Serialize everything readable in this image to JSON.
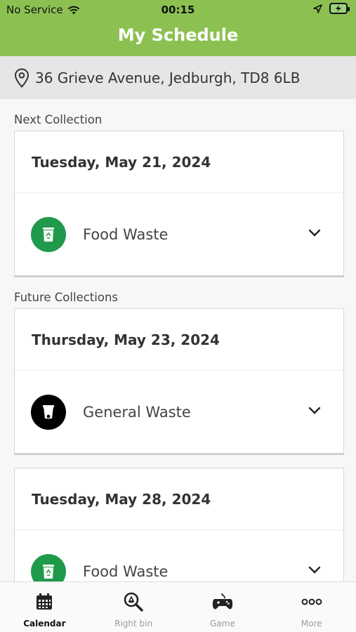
{
  "status_bar": {
    "carrier": "No Service",
    "time": "00:15"
  },
  "header": {
    "title": "My Schedule"
  },
  "address": {
    "text": "36 Grieve Avenue, Jedburgh, TD8 6LB",
    "icon": "location-pin-icon"
  },
  "next_collection": {
    "label": "Next Collection",
    "date": "Tuesday, May 21, 2024",
    "bin": "Food Waste"
  },
  "future_collections": {
    "label": "Future Collections",
    "items": [
      {
        "date": "Thursday, May 23, 2024",
        "bin": "General Waste"
      },
      {
        "date": "Tuesday, May 28, 2024",
        "bin": "Food Waste"
      }
    ]
  },
  "tabs": [
    {
      "label": "Calendar",
      "icon": "calendar-icon",
      "active": true
    },
    {
      "label": "Right bin",
      "icon": "recycle-search-icon",
      "active": false
    },
    {
      "label": "Game",
      "icon": "gamepad-icon",
      "active": false
    },
    {
      "label": "More",
      "icon": "more-icon",
      "active": false
    }
  ],
  "colors": {
    "header": "#8cc152",
    "food_bin": "#1f9a4a",
    "general_bin": "#000000"
  }
}
